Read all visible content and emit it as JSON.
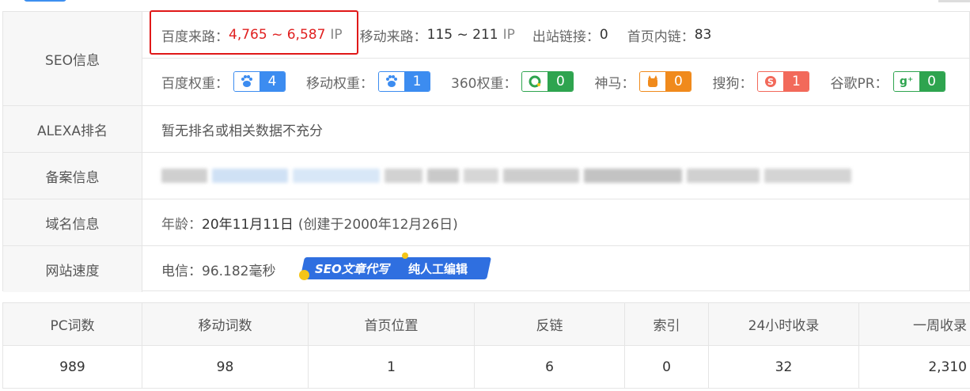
{
  "seo": {
    "label": "SEO信息",
    "baidu_traffic_label": "百度来路：",
    "baidu_traffic_value": "4,765 ~ 6,587",
    "baidu_traffic_unit": "IP",
    "mobile_traffic_label": "移动来路：",
    "mobile_traffic_value": "115 ~ 211",
    "mobile_traffic_unit": "IP",
    "outbound_label": "出站链接：",
    "outbound_value": "0",
    "home_inlinks_label": "首页内链：",
    "home_inlinks_value": "83",
    "weights": [
      {
        "label": "百度权重：",
        "value": "4",
        "color": "#3c8cf0",
        "icon": "baidu-paw-icon"
      },
      {
        "label": "移动权重：",
        "value": "1",
        "color": "#3c8cf0",
        "icon": "mobile-paw-icon"
      },
      {
        "label": "360权重：",
        "value": "0",
        "color": "#2ea44f",
        "icon": "360-icon"
      },
      {
        "label": "神马：",
        "value": "0",
        "color": "#f08a1c",
        "icon": "shenma-icon"
      },
      {
        "label": "搜狗：",
        "value": "1",
        "color": "#f2695a",
        "icon": "sogou-icon"
      },
      {
        "label": "谷歌PR：",
        "value": "0",
        "color": "#2ea44f",
        "icon": "google-plus-icon"
      }
    ]
  },
  "alexa": {
    "label": "ALEXA排名",
    "value": "暂无排名或相关数据不充分"
  },
  "icp": {
    "label": "备案信息"
  },
  "domain": {
    "label": "域名信息",
    "age_label": "年龄：",
    "age_value": "20年11月11日",
    "created": "(创建于2000年12月26日)"
  },
  "speed": {
    "label": "网站速度",
    "value": "电信：96.182毫秒",
    "ad_left": "SEO文章代写",
    "ad_right": "纯人工编辑"
  },
  "stats": {
    "headers": [
      "PC词数",
      "移动词数",
      "首页位置",
      "反链",
      "索引",
      "24小时收录",
      "一周收录"
    ],
    "values": [
      "989",
      "98",
      "1",
      "6",
      "0",
      "32",
      "2,310"
    ]
  }
}
